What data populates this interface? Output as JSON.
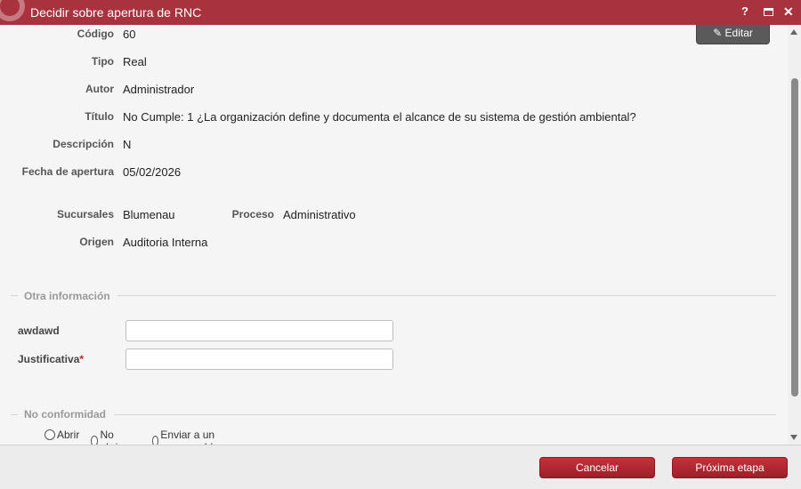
{
  "window": {
    "title": "Decidir sobre apertura de RNC",
    "help_label": "?",
    "close_label": "✕"
  },
  "record": {
    "edit_label": "Editar",
    "fields": {
      "codigo": {
        "label": "Código",
        "value": "60"
      },
      "tipo": {
        "label": "Tipo",
        "value": "Real"
      },
      "autor": {
        "label": "Autor",
        "value": "Administrador"
      },
      "titulo": {
        "label": "Título",
        "value": "No Cumple: 1 ¿La organización define y documenta el alcance de su sistema de gestión ambiental?"
      },
      "descripcion": {
        "label": "Descripción",
        "value": "N"
      },
      "fecha_apertura": {
        "label": "Fecha de apertura",
        "value": "05/02/2026"
      },
      "sucursales": {
        "label": "Sucursales",
        "value": "Blumenau"
      },
      "proceso": {
        "label": "Proceso",
        "value": "Administrativo"
      },
      "origen": {
        "label": "Origen",
        "value": "Auditoria Interna"
      }
    }
  },
  "otra_informacion": {
    "section_title": "Otra información",
    "awdawd": {
      "label": "awdawd",
      "value": ""
    },
    "justificativa": {
      "label": "Justificativa",
      "required_mark": "*",
      "value": ""
    }
  },
  "no_conformidad": {
    "section_title": "No conformidad",
    "options": [
      "Abrir",
      "No abrir",
      "Enviar a un responsable"
    ],
    "selected": null
  },
  "footer": {
    "cancel_label": "Cancelar",
    "next_label": "Próxima etapa"
  },
  "colors": {
    "titlebar": "#a8323d",
    "primary_button": "#b22a33",
    "edit_button": "#5a5a5a",
    "required": "#c0202a"
  }
}
